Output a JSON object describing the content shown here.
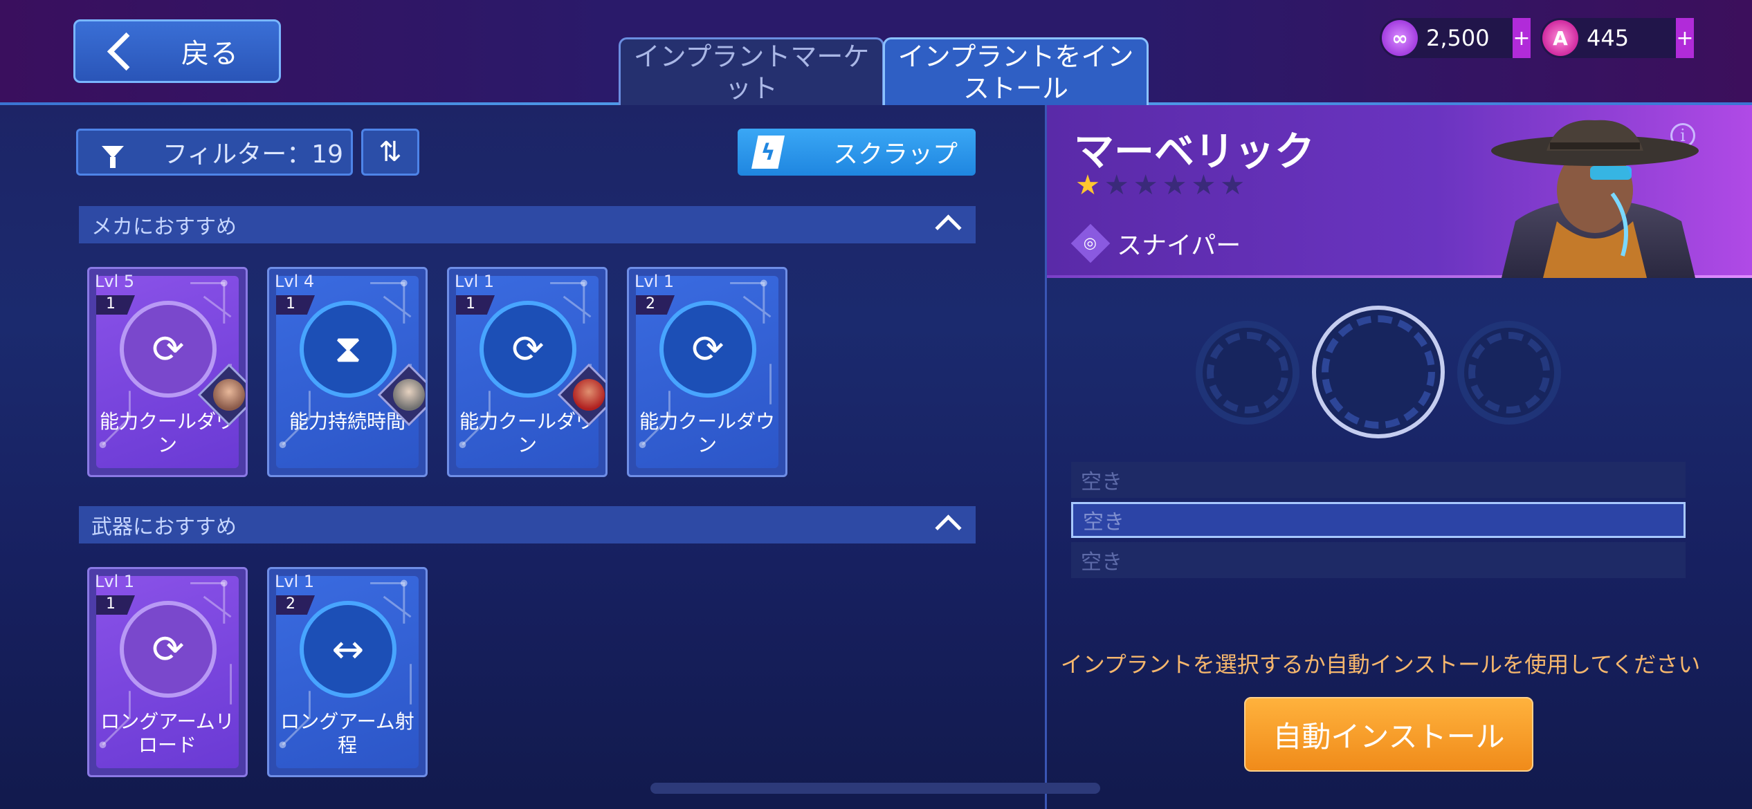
{
  "header": {
    "back_label": "戻る",
    "tabs": [
      {
        "label": "インプラントマーケット",
        "active": false
      },
      {
        "label": "インプラントをインストール",
        "active": true
      }
    ],
    "currencies": [
      {
        "icon": "link-coin-icon",
        "value": "2,500",
        "plus": "+"
      },
      {
        "icon": "a-token-icon",
        "value": "445",
        "plus": "+"
      }
    ]
  },
  "toolbar": {
    "filter_label": "フィルター：19",
    "sort_icon": "sort-arrows-icon",
    "scrap_label": "スクラップ"
  },
  "sections": [
    {
      "title": "メカにおすすめ",
      "cards": [
        {
          "level": "Lvl 5",
          "count": "1",
          "glyph": "⟳",
          "name": "能力クールダウン",
          "style": "purple",
          "hero_badge": "pink"
        },
        {
          "level": "Lvl 4",
          "count": "1",
          "glyph": "⧗",
          "name": "能力持続時間",
          "style": "blue",
          "hero_badge": "gray"
        },
        {
          "level": "Lvl 1",
          "count": "1",
          "glyph": "⟳",
          "name": "能力クールダウン",
          "style": "blue",
          "hero_badge": "red"
        },
        {
          "level": "Lvl 1",
          "count": "2",
          "glyph": "⟳",
          "name": "能力クールダウン",
          "style": "blue",
          "hero_badge": ""
        }
      ]
    },
    {
      "title": "武器におすすめ",
      "cards": [
        {
          "level": "Lvl 1",
          "count": "1",
          "glyph": "⟳",
          "name": "ロングアームリロード",
          "style": "purple",
          "hero_badge": ""
        },
        {
          "level": "Lvl 1",
          "count": "2",
          "glyph": "↔",
          "name": "ロングアーム射程",
          "style": "blue",
          "hero_badge": ""
        }
      ]
    }
  ],
  "hero": {
    "name": "マーベリック",
    "stars_filled": 1,
    "stars_total": 6,
    "role": "スナイパー",
    "info": "i"
  },
  "slots": [
    {
      "label": "空き",
      "selected": false
    },
    {
      "label": "空き",
      "selected": true
    },
    {
      "label": "空き",
      "selected": false
    }
  ],
  "hint": "インプラントを選択するか自動インストールを使用してください",
  "auto_install_label": "自動インストール",
  "colors": {
    "accent_orange": "#f6a12a",
    "card_purple": "#7a48cc",
    "card_blue": "#2c56c8",
    "star_on": "#ffc630"
  }
}
